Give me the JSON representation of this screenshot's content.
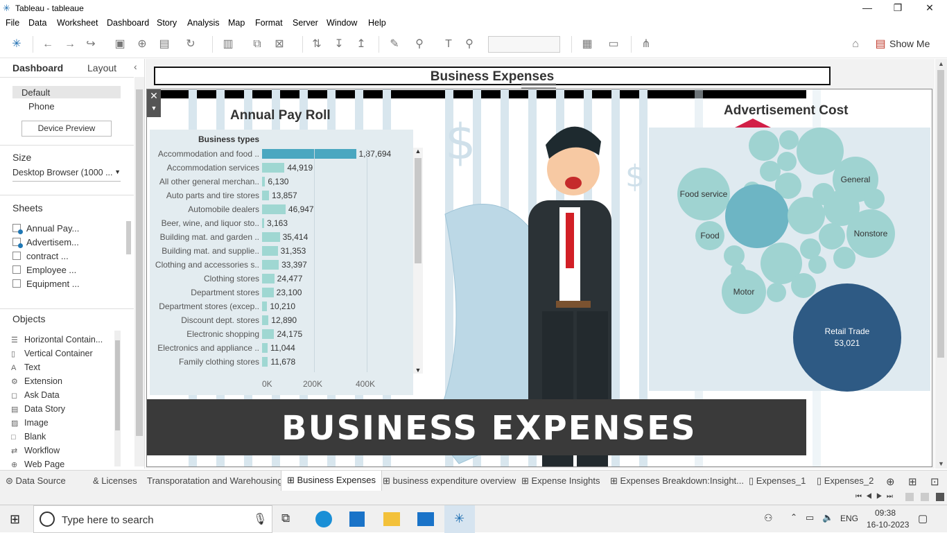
{
  "window": {
    "title": "Tableau - tableaue"
  },
  "menu": [
    "File",
    "Data",
    "Worksheet",
    "Dashboard",
    "Story",
    "Analysis",
    "Map",
    "Format",
    "Server",
    "Window",
    "Help"
  ],
  "toolbar": {
    "show_me": "Show Me"
  },
  "left_panel": {
    "tabs": [
      "Dashboard",
      "Layout"
    ],
    "device": {
      "default": "Default",
      "phone": "Phone",
      "preview_button": "Device Preview"
    },
    "size": {
      "heading": "Size",
      "value": "Desktop Browser (1000 ..."
    },
    "sheets": {
      "heading": "Sheets",
      "items": [
        "Annual Pay...",
        "Advertisem...",
        "contract ...",
        "Employee ...",
        "Equipment ..."
      ]
    },
    "objects": {
      "heading": "Objects",
      "items": [
        "Horizontal Contain...",
        "Vertical Container",
        "Text",
        "Extension",
        "Ask Data",
        "Data Story",
        "Image",
        "Blank",
        "Workflow",
        "Web Page"
      ]
    }
  },
  "dashboard": {
    "title": "Business Expenses",
    "banner": "BUSINESS EXPENSES",
    "payroll": {
      "title": "Annual Pay Roll",
      "header": "Business types",
      "axis_ticks": [
        "0K",
        "200K",
        "400K"
      ]
    },
    "advertisement": {
      "title": "Advertisement Cost",
      "bubbles": [
        {
          "label": "Food service"
        },
        {
          "label": "General"
        },
        {
          "label": "Food"
        },
        {
          "label": "Nonstore"
        },
        {
          "label": "Motor"
        },
        {
          "label": "Retail Trade",
          "value": "53,021"
        }
      ]
    }
  },
  "chart_data": {
    "type": "bar",
    "title": "Annual Pay Roll",
    "ylabel": "Business types",
    "categories": [
      "Accommodation and food ..",
      "Accommodation services",
      "All other general merchan..",
      "Auto parts and tire stores",
      "Automobile dealers",
      "Beer, wine, and liquor sto..",
      "Building mat. and garden ..",
      "Building mat. and supplie..",
      "Clothing and accessories s..",
      "Clothing stores",
      "Department stores",
      "Department stores (excep..",
      "Discount dept. stores",
      "Electronic shopping",
      "Electronics and appliance ..",
      "Family clothing stores"
    ],
    "labels": [
      "1,87,694",
      "44,919",
      "6,130",
      "13,857",
      "46,947",
      "3,163",
      "35,414",
      "31,353",
      "33,397",
      "24,477",
      "23,100",
      "10,210",
      "12,890",
      "24,175",
      "11,044",
      "11,678"
    ],
    "values": [
      187694,
      44919,
      6130,
      13857,
      46947,
      3163,
      35414,
      31353,
      33397,
      24477,
      23100,
      10210,
      12890,
      24175,
      11044,
      11678
    ],
    "xlim": [
      0,
      500000
    ],
    "ticks": [
      "0K",
      "200K",
      "400K"
    ]
  },
  "bottom_tabs": [
    "Data Source",
    "& Licenses",
    "Transporatation and Warehousing",
    "Business Expenses",
    "business expenditure overview",
    "Expense Insights",
    "Expenses Breakdown:Insight...",
    "Expenses_1",
    "Expenses_2"
  ],
  "taskbar": {
    "search_placeholder": "Type here to search",
    "lang": "ENG",
    "time": "09:38",
    "date": "16-10-2023"
  },
  "colors": {
    "bar": "#9fd7d2",
    "bar_highlight": "#4aa7c0",
    "bubble": "#9fd3d1",
    "bubble_large": "#2e5a84"
  }
}
